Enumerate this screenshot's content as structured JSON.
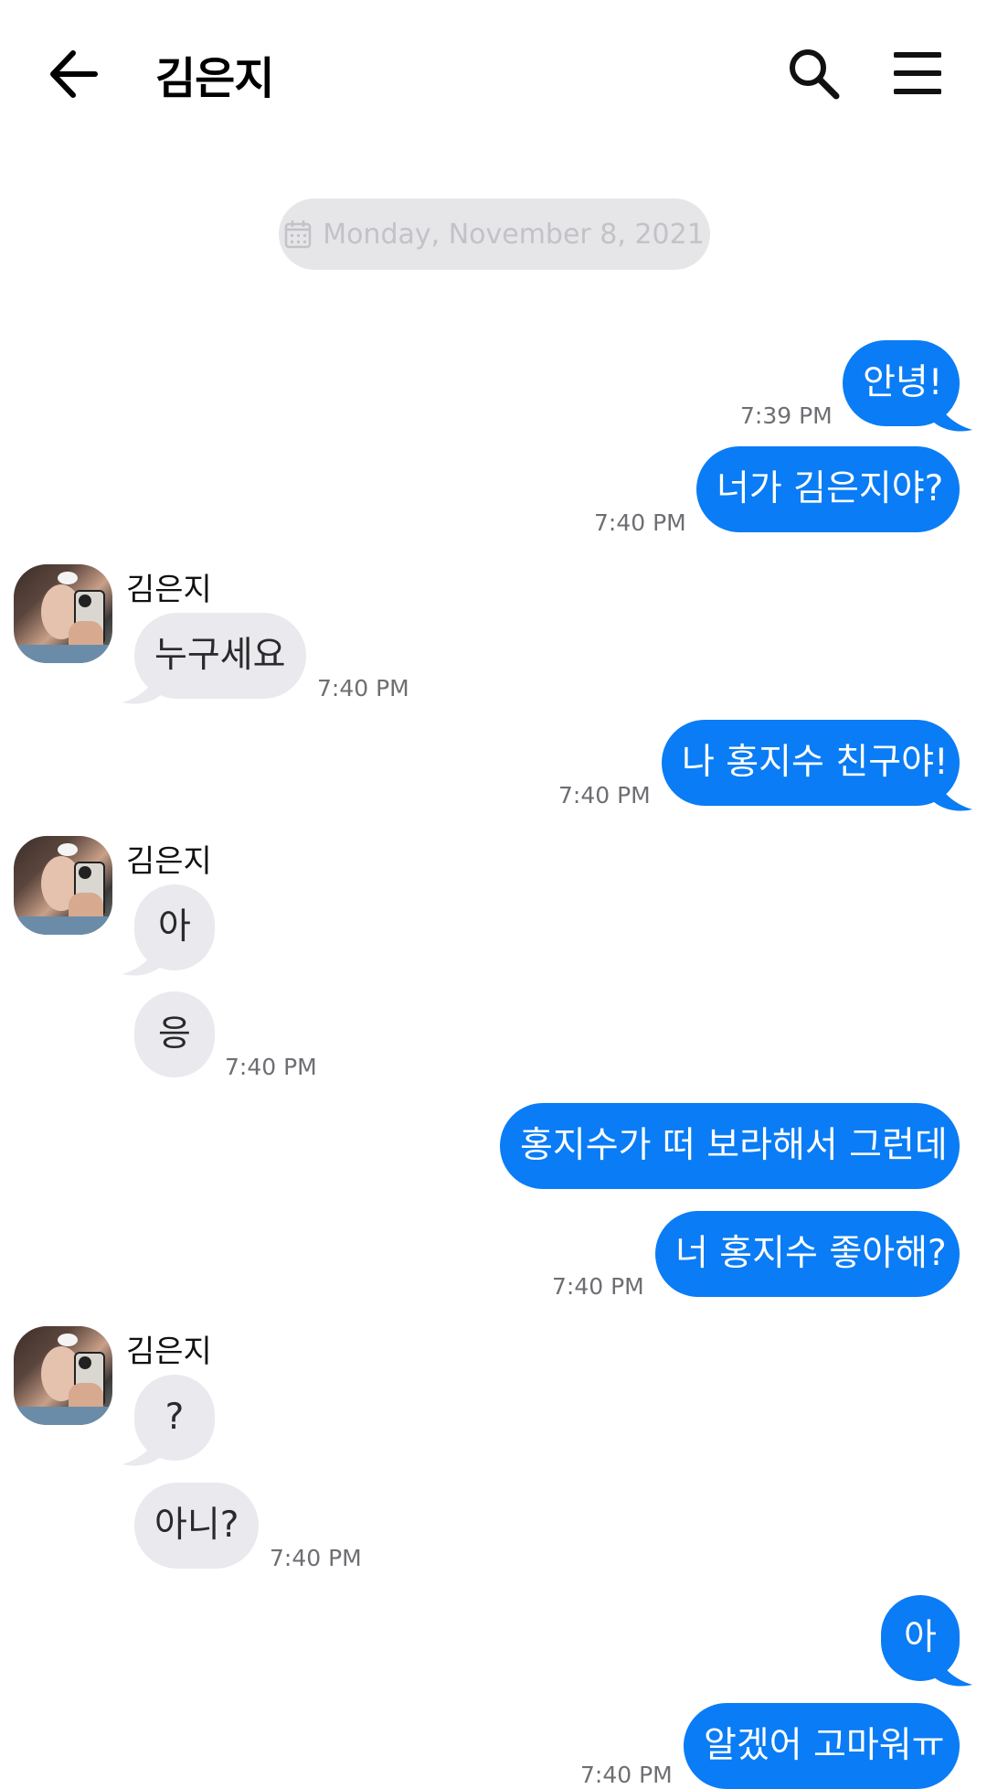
{
  "header": {
    "title": "김은지"
  },
  "icons": {
    "back": "arrow-left-icon",
    "search": "search-icon",
    "menu": "hamburger-menu-icon",
    "date": "calendar-icon"
  },
  "colors": {
    "outgoing": "#0a7cf5",
    "incoming": "#e9e9ee"
  },
  "date_separator": "Monday, November 8, 2021",
  "messages": [
    {
      "text": "안녕!",
      "time": "7:39 PM"
    },
    {
      "text": "너가 김은지야?",
      "time": "7:40 PM"
    },
    {
      "sender": "김은지",
      "text": "누구세요",
      "time": "7:40 PM"
    },
    {
      "text": "나 홍지수 친구야!",
      "time": "7:40 PM"
    },
    {
      "sender": "김은지",
      "text": "아"
    },
    {
      "text": "응",
      "time": "7:40 PM"
    },
    {
      "text": "홍지수가 떠 보라해서 그런데"
    },
    {
      "text": "너 홍지수 좋아해?",
      "time": "7:40 PM"
    },
    {
      "sender": "김은지",
      "text": "?"
    },
    {
      "text": "아니?",
      "time": "7:40 PM"
    },
    {
      "text": "아"
    },
    {
      "text": "알겠어 고마워ㅠ",
      "time": "7:40 PM"
    }
  ]
}
